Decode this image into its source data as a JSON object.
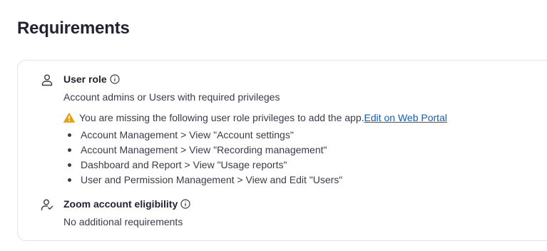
{
  "page": {
    "title": "Requirements"
  },
  "user_role": {
    "title": "User role",
    "icon": "user-icon",
    "info_icon": "info-icon",
    "description": "Account admins or Users with required privileges",
    "warning": {
      "icon": "warning-icon",
      "color": "#e8a10a",
      "text": "You are missing the following user role privileges to add the app.",
      "link_label": "Edit on Web Portal",
      "link_color": "#0e5ec4"
    },
    "privileges": [
      "Account Management > View \"Account settings\"",
      "Account Management > View \"Recording management\"",
      "Dashboard and Report > View \"Usage reports\"",
      "User and Permission Management > View and Edit \"Users\""
    ]
  },
  "account_eligibility": {
    "title": "Zoom account eligibility",
    "icon": "user-check-icon",
    "info_icon": "info-icon",
    "description": "No additional requirements"
  }
}
